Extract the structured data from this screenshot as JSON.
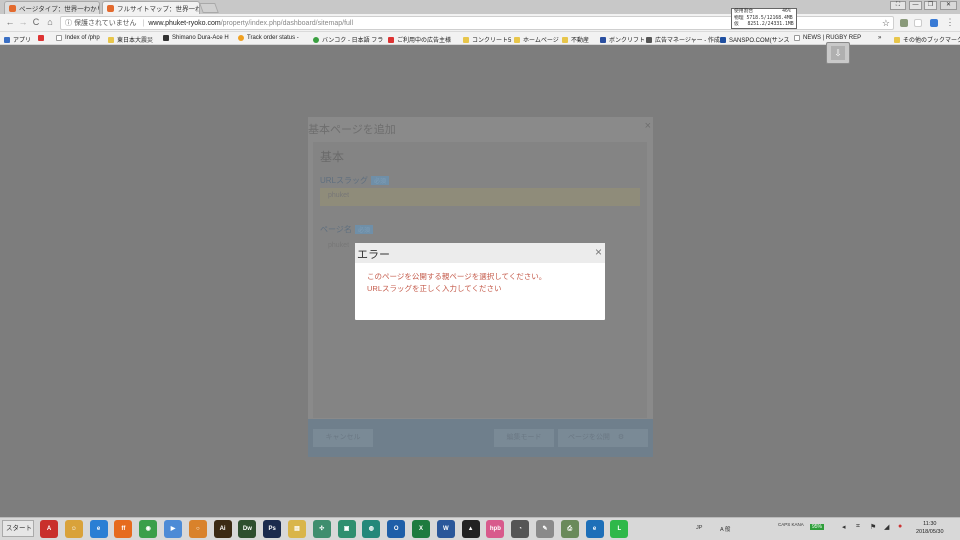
{
  "tabs": [
    {
      "label": "ページタイプ：世界一わかり",
      "close": "×",
      "active": false
    },
    {
      "label": "フルサイトマップ：世界一わか",
      "close": "×",
      "active": true
    }
  ],
  "memory_monitor": {
    "line1": "使用割合          46%",
    "line2": "物理 5718.5/12168.4MB",
    "line3": "仮   8251.2/24331.1MB"
  },
  "window_buttons": {
    "minimize": "—",
    "restore": "❐",
    "close": "✕",
    "extra": "⛶"
  },
  "toolbar": {
    "back": "←",
    "forward": "→",
    "reload": "C",
    "home": "⌂",
    "security_text": "ⓘ 保護されていません",
    "url_host": "www.phuket-ryoko.com",
    "url_path": "/property/index.php/dashboard/sitemap/full",
    "star": "☆",
    "menu": "⋮"
  },
  "bookmarks": {
    "apps": "アプリ",
    "items": [
      "Index of /php",
      "東日本大震災",
      "Shimano Dura-Ace H",
      "Track order status -",
      "バンコク - 日本語 フラ",
      "ご利用中の広告主様",
      "コンクリート5",
      "ホームページ",
      "不動産",
      "ボンクリフト",
      "広告マネージャー - 作成",
      "SANSPO.COM(サンス",
      "NEWS | RUGBY REP"
    ],
    "more": "»",
    "other": "その他のブックマーク"
  },
  "background_dialog": {
    "title": "基本ページを追加",
    "close": "×",
    "section": "基本",
    "url_slug_label": "URLスラッグ",
    "url_slug_badge": "必須",
    "url_slug_value": "phuket",
    "page_name_label": "ページ名",
    "page_name_badge": "必須",
    "page_name_value": "phuket",
    "cancel": "キャンセル",
    "edit_mode": "編集モード",
    "publish": "ページを公開"
  },
  "modal": {
    "title": "エラー",
    "close": "×",
    "message_1": "このページを公開する親ページを選択してください。",
    "message_2": "URLスラッグを正しく入力してください"
  },
  "taskbar": {
    "start": "スタート",
    "apps": [
      {
        "name": "acrobat",
        "glyph": "A",
        "color": "#c9302c"
      },
      {
        "name": "avatar",
        "glyph": "☺",
        "color": "#d9a23a"
      },
      {
        "name": "ie",
        "glyph": "e",
        "color": "#2a7fd4"
      },
      {
        "name": "firefox",
        "glyph": "ff",
        "color": "#e66b1e"
      },
      {
        "name": "chrome",
        "glyph": "◉",
        "color": "#3a9f4a"
      },
      {
        "name": "media",
        "glyph": "▶",
        "color": "#4d8bd6"
      },
      {
        "name": "search",
        "glyph": "○",
        "color": "#d9822b"
      },
      {
        "name": "illustrator",
        "glyph": "Ai",
        "color": "#3b2a14"
      },
      {
        "name": "dreamweaver",
        "glyph": "Dw",
        "color": "#2f4f2f"
      },
      {
        "name": "photoshop",
        "glyph": "Ps",
        "color": "#1b2b4d"
      },
      {
        "name": "folder",
        "glyph": "▤",
        "color": "#d9b54a"
      },
      {
        "name": "network",
        "glyph": "✣",
        "color": "#3f8e6e"
      },
      {
        "name": "monitor",
        "glyph": "▣",
        "color": "#2f8f6f"
      },
      {
        "name": "globe",
        "glyph": "◍",
        "color": "#23887a"
      },
      {
        "name": "outlook",
        "glyph": "O",
        "color": "#1f5fa8"
      },
      {
        "name": "excel",
        "glyph": "X",
        "color": "#1e7b3f"
      },
      {
        "name": "word",
        "glyph": "W",
        "color": "#2a579a"
      },
      {
        "name": "vectorworks",
        "glyph": "▲",
        "color": "#222222"
      },
      {
        "name": "hpb",
        "glyph": "hpb",
        "color": "#d85a8c"
      },
      {
        "name": "headset",
        "glyph": "◔",
        "color": "#555555"
      },
      {
        "name": "tool",
        "glyph": "✎",
        "color": "#8a8a8a"
      },
      {
        "name": "printer",
        "glyph": "⎙",
        "color": "#6a8a5a"
      },
      {
        "name": "edge",
        "glyph": "e",
        "color": "#1d6fb8"
      },
      {
        "name": "line",
        "glyph": "L",
        "color": "#2fb84a"
      }
    ],
    "ime": "JP",
    "ime_mode": "A 般",
    "caps": "CAPS KANA",
    "battery": "95%",
    "time": "11:30",
    "date": "2018/05/30"
  }
}
